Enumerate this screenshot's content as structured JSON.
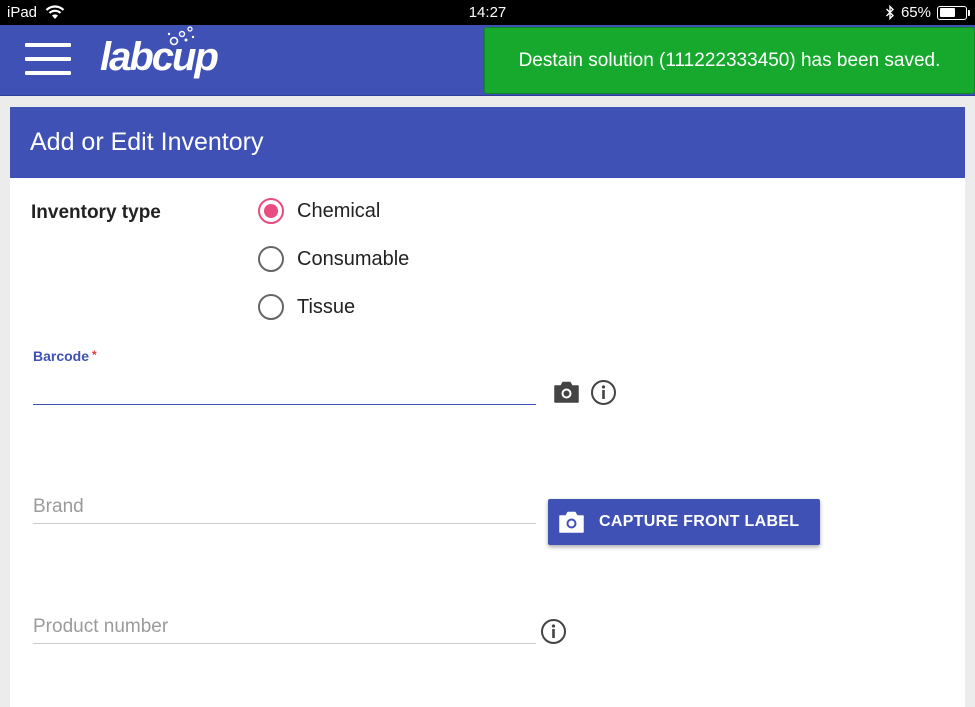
{
  "status_bar": {
    "device": "iPad",
    "time": "14:27",
    "battery": "65%",
    "battery_level": 0.65
  },
  "app_bar": {
    "logo_text": "labcup"
  },
  "toast": {
    "message": "Destain solution (111222333450) has been saved."
  },
  "form": {
    "title": "Add or Edit Inventory",
    "inventory_type_label": "Inventory type",
    "inventory_types": [
      {
        "label": "Chemical",
        "selected": true
      },
      {
        "label": "Consumable",
        "selected": false
      },
      {
        "label": "Tissue",
        "selected": false
      }
    ],
    "barcode_label": "Barcode",
    "barcode_required_mark": "*",
    "barcode_value": "",
    "brand_placeholder": "Brand",
    "capture_button_label": "CAPTURE FRONT LABEL",
    "product_number_placeholder": "Product number"
  },
  "colors": {
    "primary": "#3f51b5",
    "toast_green": "#17a92d",
    "radio_accent": "#e94c7f"
  },
  "icons": {
    "wifi": "wifi-icon",
    "bluetooth": "bluetooth-icon",
    "battery": "battery-icon",
    "menu": "hamburger-menu-icon",
    "camera": "camera-icon",
    "info": "info-icon"
  }
}
